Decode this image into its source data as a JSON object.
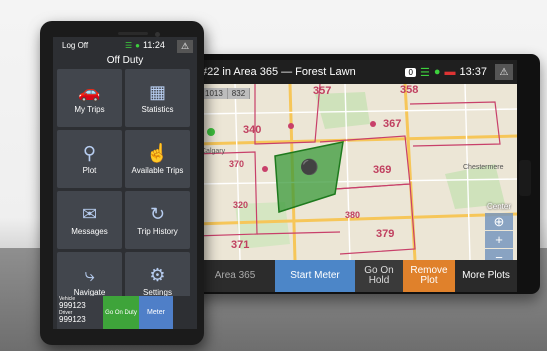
{
  "tablet": {
    "title": "#22 in Area 365 — Forest Lawn",
    "badge": "0",
    "time": "13:37",
    "icons": {
      "wifi": "wifi-icon",
      "gps": "gps-pin-icon",
      "battery": "battery-icon",
      "warning": "warning-icon"
    },
    "mini_tabs": [
      "1013",
      "832"
    ],
    "map_labels": [
      "357",
      "358",
      "340",
      "367",
      "369",
      "370",
      "379",
      "371",
      "320",
      "380"
    ],
    "map_places": [
      "Calgary",
      "Chestermere"
    ],
    "map_controls": {
      "center": "Center",
      "zoom_in": "+",
      "zoom_out": "−"
    },
    "bottom": {
      "area": "Area 365",
      "start_meter": "Start Meter",
      "go_on_hold": "Go On Hold",
      "remove_plot": "Remove Plot",
      "more_plots": "More Plots"
    }
  },
  "phone": {
    "logoff": "Log Off",
    "time": "11:24",
    "status": "Off Duty",
    "tiles": [
      {
        "label": "My Trips",
        "icon": "car-icon"
      },
      {
        "label": "Statistics",
        "icon": "bar-chart-icon"
      },
      {
        "label": "Plot",
        "icon": "map-pin-icon"
      },
      {
        "label": "Available Trips",
        "icon": "hand-pointer-icon"
      },
      {
        "label": "Messages",
        "icon": "envelope-icon"
      },
      {
        "label": "Trip History",
        "icon": "history-icon"
      },
      {
        "label": "Navigate",
        "icon": "route-icon"
      },
      {
        "label": "Settings",
        "icon": "gear-icon"
      }
    ],
    "vehicle_label": "Vehicle",
    "vehicle": "999123",
    "driver_label": "Driver",
    "driver": "999123",
    "go_on_duty": "Go On Duty",
    "meter": "Meter"
  },
  "colors": {
    "accent_blue": "#4c86c8",
    "orange": "#e0812b",
    "green": "#3ea43a",
    "plot_fill": "#3a9a3a"
  }
}
